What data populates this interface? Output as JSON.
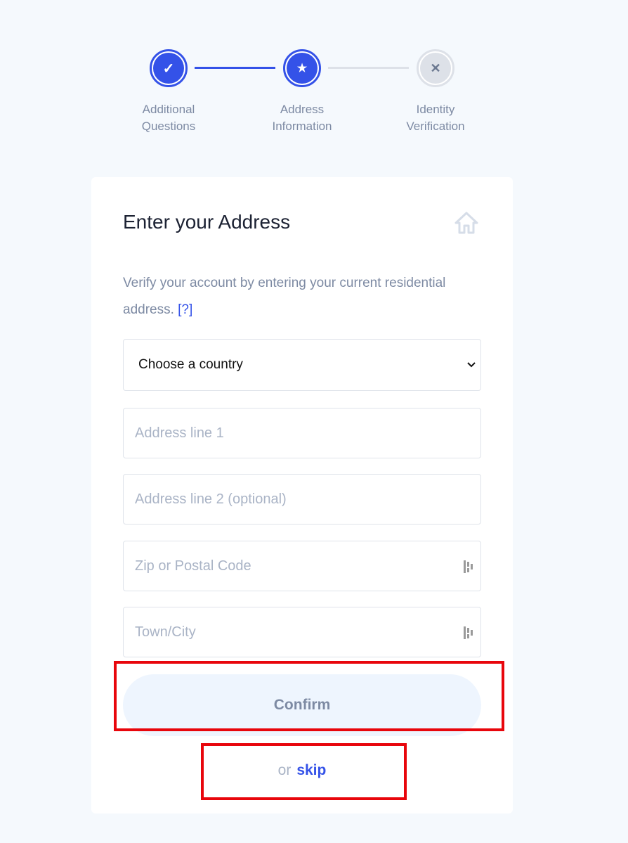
{
  "stepper": {
    "steps": [
      {
        "label_line1": "Additional",
        "label_line2": "Questions",
        "state": "completed",
        "icon": "check-icon",
        "glyph": "✓"
      },
      {
        "label_line1": "Address",
        "label_line2": "Information",
        "state": "current",
        "icon": "star-icon",
        "glyph": "★"
      },
      {
        "label_line1": "Identity",
        "label_line2": "Verification",
        "state": "pending",
        "icon": "x-icon",
        "glyph": "✕"
      }
    ],
    "colors": {
      "active": "#3452e8",
      "inactive": "#dde1e8"
    }
  },
  "card": {
    "title": "Enter your Address",
    "title_icon": "home-icon",
    "description": "Verify your account by entering your current residential address.",
    "help_link": "[?]",
    "country_select": {
      "selected": "Choose a country"
    },
    "fields": {
      "address1_placeholder": "Address line 1",
      "address2_placeholder": "Address line 2 (optional)",
      "zip_placeholder": "Zip or Postal Code",
      "city_placeholder": "Town/City"
    },
    "confirm_label": "Confirm",
    "or_text": "or",
    "skip_label": "skip"
  },
  "annotations": {
    "highlight_color": "#e8060c"
  }
}
